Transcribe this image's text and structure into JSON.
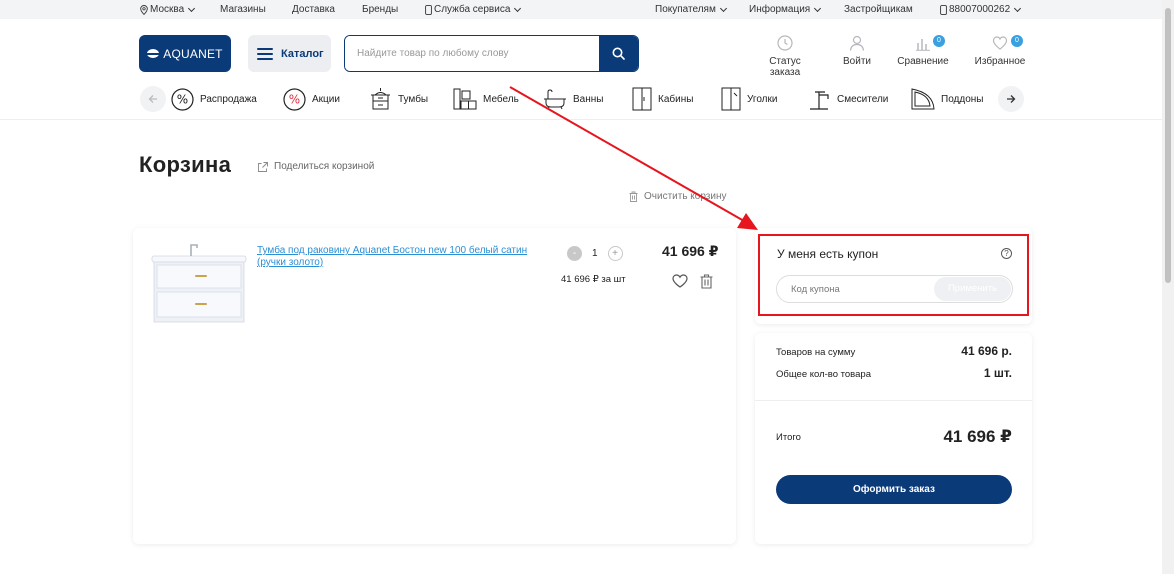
{
  "topbar": {
    "city": "Москва",
    "stores": "Магазины",
    "delivery": "Доставка",
    "brands": "Бренды",
    "service": "Служба сервиса",
    "buyers": "Покупателям",
    "info": "Информация",
    "developers": "Застройщикам",
    "phone": "88007000262"
  },
  "header": {
    "logo": "AQUANET",
    "catalog": "Каталог",
    "search_placeholder": "Найдите товар по любому слову",
    "order_status": "Статус заказа",
    "login": "Войти",
    "compare": "Сравнение",
    "compare_count": "0",
    "favorites": "Избранное",
    "favorites_count": "0"
  },
  "categories": [
    "Распродажа",
    "Акции",
    "Тумбы",
    "Мебель",
    "Ванны",
    "Кабины",
    "Уголки",
    "Смесители",
    "Поддоны"
  ],
  "cart": {
    "title": "Корзина",
    "share": "Поделиться корзиной",
    "clear": "Очистить корзину"
  },
  "product": {
    "name": "Тумба под раковину Aquanet Бостон new 100 белый сатин (ручки золото)",
    "qty_minus": "-",
    "quantity": "1",
    "qty_plus": "+",
    "price": "41 696 ₽",
    "unit_price": "41 696 ₽ за шт"
  },
  "coupon": {
    "title": "У меня есть купон",
    "help": "?",
    "placeholder": "Код купона",
    "apply": "Применить"
  },
  "summary": {
    "goods_label": "Товаров на сумму",
    "goods_value": "41 696 р.",
    "count_label": "Общее кол-во товара",
    "count_value": "1 шт.",
    "total_label": "Итого",
    "total_value": "41 696 ₽",
    "checkout": "Оформить заказ"
  },
  "colors": {
    "brand": "#0b3a78",
    "link": "#2b8fd6",
    "badge": "#3aa0e0",
    "annotation": "#e6151e"
  }
}
